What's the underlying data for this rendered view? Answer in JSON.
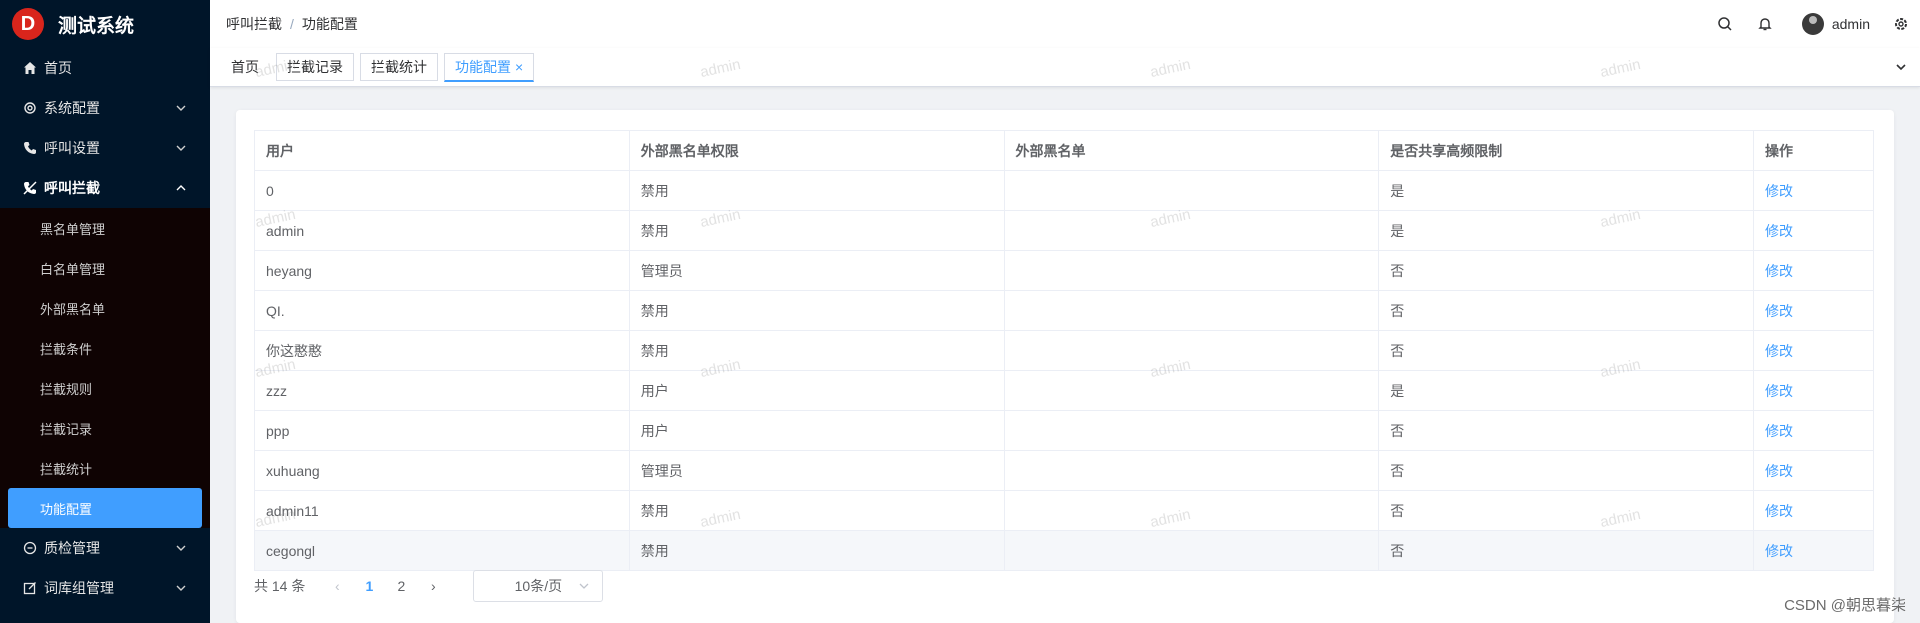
{
  "app": {
    "title": "测试系统",
    "logo_letter": "D"
  },
  "sidebar": {
    "items": [
      {
        "label": "首页",
        "icon": "home-icon"
      },
      {
        "label": "系统配置",
        "icon": "gear-icon"
      },
      {
        "label": "呼叫设置",
        "icon": "phone-icon"
      },
      {
        "label": "呼叫拦截",
        "icon": "block-call-icon"
      },
      {
        "label": "质检管理",
        "icon": "chat-icon"
      },
      {
        "label": "词库组管理",
        "icon": "edit-icon"
      }
    ],
    "submenu": [
      "黑名单管理",
      "白名单管理",
      "外部黑名单",
      "拦截条件",
      "拦截规则",
      "拦截记录",
      "拦截统计",
      "功能配置"
    ]
  },
  "header": {
    "breadcrumb": [
      "呼叫拦截",
      "功能配置"
    ],
    "user": "admin"
  },
  "tabs": [
    {
      "label": "首页"
    },
    {
      "label": "拦截记录"
    },
    {
      "label": "拦截统计"
    },
    {
      "label": "功能配置",
      "close": "×"
    }
  ],
  "table": {
    "columns": [
      "用户",
      "外部黑名单权限",
      "外部黑名单",
      "是否共享高频限制",
      "操作"
    ],
    "action_label": "修改",
    "rows": [
      [
        "0",
        "禁用",
        "",
        "是"
      ],
      [
        "admin",
        "禁用",
        "",
        "是"
      ],
      [
        "heyang",
        "管理员",
        "",
        "否"
      ],
      [
        "QI.",
        "禁用",
        "",
        "否"
      ],
      [
        "你这憨憨",
        "禁用",
        "",
        "否"
      ],
      [
        "zzz",
        "用户",
        "",
        "是"
      ],
      [
        "ppp",
        "用户",
        "",
        "否"
      ],
      [
        "xuhuang",
        "管理员",
        "",
        "否"
      ],
      [
        "admin11",
        "禁用",
        "",
        "否"
      ],
      [
        "cegongl",
        "禁用",
        "",
        "否"
      ]
    ]
  },
  "pagination": {
    "total_text": "共 14 条",
    "pages": [
      "1",
      "2"
    ],
    "current": "1",
    "page_size": "10条/页"
  },
  "watermark": "admin",
  "credit": "CSDN @朝思暮柒",
  "colors": {
    "primary": "#409eff",
    "sidebar_bg": "#001529"
  }
}
